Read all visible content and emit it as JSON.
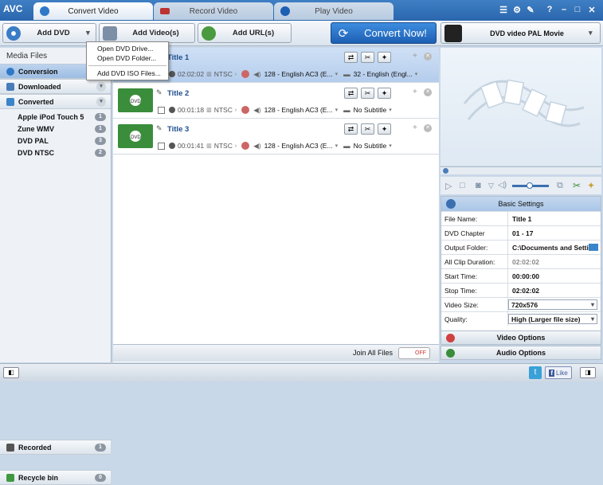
{
  "app": {
    "logo": "AVC"
  },
  "tabs": [
    {
      "label": "Convert Video"
    },
    {
      "label": "Record Video"
    },
    {
      "label": "Play Video"
    }
  ],
  "toolbar": {
    "add_dvd": "Add DVD",
    "add_videos": "Add Video(s)",
    "add_urls": "Add URL(s)",
    "convert_now": "Convert Now!",
    "profile": "DVD video PAL Movie"
  },
  "dvd_menu": {
    "items": [
      "Open DVD Drive...",
      "Open DVD Folder...",
      "Add DVD ISO Files..."
    ]
  },
  "sidebar": {
    "header": "Media Files",
    "conversion": "Conversion",
    "downloaded": "Downloaded",
    "converted": "Converted",
    "items": [
      {
        "label": "Apple iPod Touch 5",
        "count": "1"
      },
      {
        "label": "Zune WMV",
        "count": "1"
      },
      {
        "label": "DVD PAL",
        "count": "3"
      },
      {
        "label": "DVD NTSC",
        "count": "2"
      }
    ],
    "recorded": {
      "label": "Recorded",
      "count": "1"
    },
    "recycle": {
      "label": "Recycle bin",
      "count": "0"
    }
  },
  "titles": [
    {
      "name": "Title 1",
      "duration": "02:02:02",
      "format": "NTSC",
      "audio": "128 - English AC3 (E...",
      "subtitle": "32 - English (Engl..."
    },
    {
      "name": "Title 2",
      "duration": "00:01:18",
      "format": "NTSC",
      "audio": "128 - English AC3 (E...",
      "subtitle": "No Subtitle"
    },
    {
      "name": "Title 3",
      "duration": "00:01:41",
      "format": "NTSC",
      "audio": "128 - English AC3 (E...",
      "subtitle": "No Subtitle"
    }
  ],
  "thumb_label": "DVD",
  "join": {
    "label": "Join All Files",
    "state": "OFF"
  },
  "settings": {
    "header": "Basic Settings",
    "rows": [
      {
        "key": "File Name:",
        "value": "Title 1"
      },
      {
        "key": "DVD Chapter",
        "value": "01  -  17"
      },
      {
        "key": "Output Folder:",
        "value": "C:\\Documents and Setti..."
      },
      {
        "key": "All Clip Duration:",
        "value": "02:02:02"
      },
      {
        "key": "Start Time:",
        "value": "00:00:00"
      },
      {
        "key": "Stop Time:",
        "value": "02:02:02"
      },
      {
        "key": "Video Size:",
        "value": "720x576"
      },
      {
        "key": "Quality:",
        "value": "High (Larger file size)"
      }
    ],
    "video_options": "Video Options",
    "audio_options": "Audio Options"
  },
  "status": {
    "like": "Like"
  },
  "colors": {
    "accent": "#2a66ad",
    "convert": "#1d5fb3",
    "selected_row": "#b4cdec",
    "thumb": "#3a8d3a"
  }
}
